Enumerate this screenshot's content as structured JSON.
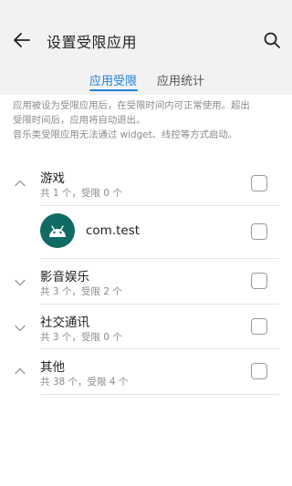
{
  "header": {
    "title": "设置受限应用",
    "back_icon": "arrow-left-icon",
    "search_icon": "search-icon"
  },
  "tabs": [
    {
      "label": "应用受限",
      "active": true
    },
    {
      "label": "应用统计",
      "active": false
    }
  ],
  "description": {
    "line1": "应用被设为受限应用后，在受限时间内可正常使用。超出",
    "line2": "受限时间后，应用将自动退出。",
    "line3": "音乐类受限应用无法通过 widget、线控等方式启动。"
  },
  "categories": [
    {
      "title": "游戏",
      "subtitle": "共 1 个，受限 0 个",
      "expanded": true,
      "checked": false
    },
    {
      "title": "影音娱乐",
      "subtitle": "共 3 个，受限 2 个",
      "expanded": false,
      "checked": false
    },
    {
      "title": "社交通讯",
      "subtitle": "共 3 个，受限 0 个",
      "expanded": false,
      "checked": false
    },
    {
      "title": "其他",
      "subtitle": "共 38 个，受限 4 个",
      "expanded": true,
      "checked": false
    }
  ],
  "apps": [
    {
      "name": "com.test",
      "icon": "android-icon",
      "checked": false
    }
  ],
  "colors": {
    "accent": "#1f7fd9",
    "app_icon_bg": "#0f6b63",
    "topbar_bg": "#f2f2f2"
  }
}
